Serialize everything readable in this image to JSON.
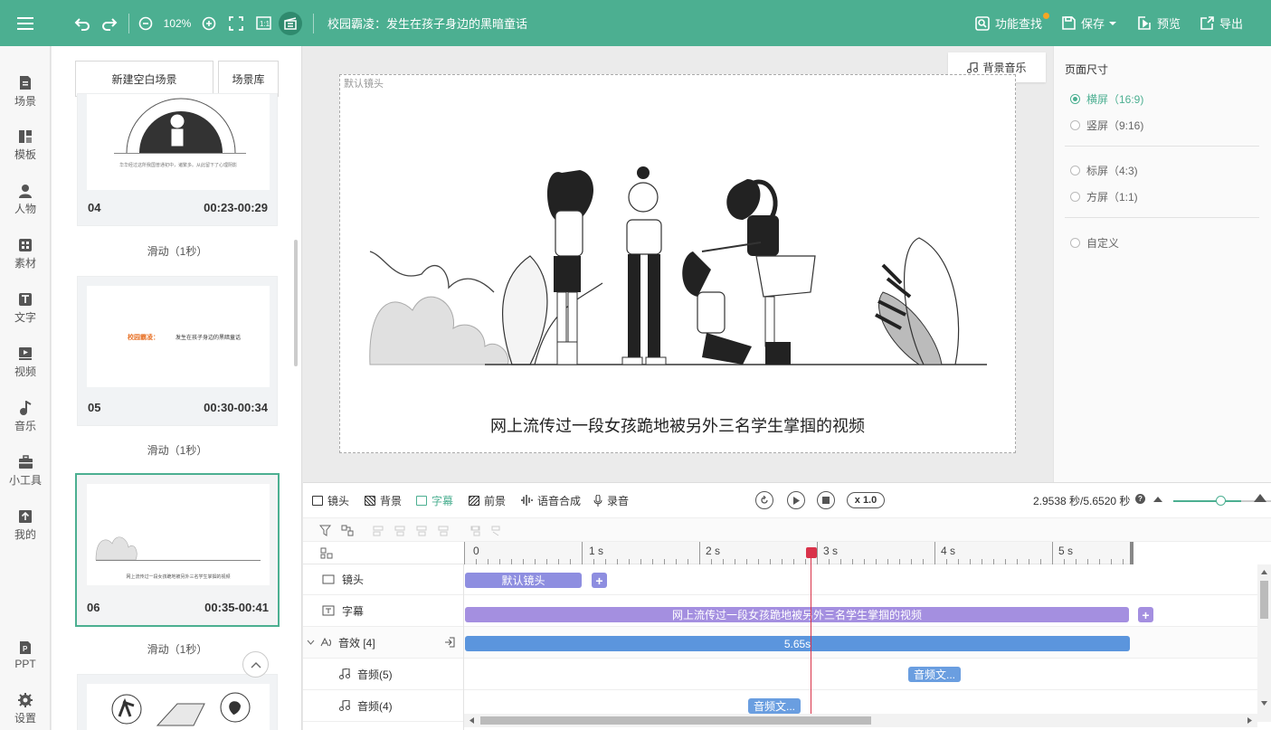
{
  "topbar": {
    "zoom": "102%",
    "title": "校园霸凌：发生在孩子身边的黑暗童话",
    "search_label": "功能查找",
    "save_label": "保存",
    "preview_label": "预览",
    "export_label": "导出"
  },
  "leftnav": {
    "items": [
      {
        "label": "场景",
        "icon": "scene-icon"
      },
      {
        "label": "模板",
        "icon": "template-icon"
      },
      {
        "label": "人物",
        "icon": "person-icon"
      },
      {
        "label": "素材",
        "icon": "material-icon"
      },
      {
        "label": "文字",
        "icon": "text-icon"
      },
      {
        "label": "视频",
        "icon": "video-icon"
      },
      {
        "label": "音乐",
        "icon": "music-icon"
      },
      {
        "label": "小工具",
        "icon": "toolbox-icon"
      },
      {
        "label": "我的",
        "icon": "upload-icon"
      },
      {
        "label": "PPT",
        "icon": "ppt-icon"
      },
      {
        "label": "设置",
        "icon": "gear-icon"
      }
    ]
  },
  "scenes": {
    "new_blank": "新建空白场景",
    "library": "场景库",
    "cards": [
      {
        "num": "04",
        "time": "00:23-00:29",
        "caption": "华华经过这所我国普通初中，诸繁多。从此留下了心理阴影"
      },
      {
        "num": "05",
        "time": "00:30-00:34",
        "caption_a": "校园霸凌：",
        "caption_b": "发生在孩子身边的黑暗童话"
      },
      {
        "num": "06",
        "time": "00:35-00:41",
        "caption": "网上流传过一段女孩跪地被另外三名学生掌掴的视频"
      }
    ],
    "transition": "滑动（1秒）"
  },
  "canvas": {
    "bg_music": "背景音乐",
    "camera_label": "默认镜头",
    "subtitle": "网上流传过一段女孩跪地被另外三名学生掌掴的视频"
  },
  "rightpanel": {
    "title": "页面尺寸",
    "options": [
      "横屏（16:9)",
      "竖屏（9:16)",
      "标屏（4:3)",
      "方屏（1:1)",
      "自定义"
    ],
    "selected": 0
  },
  "timeline": {
    "tabs": [
      "镜头",
      "背景",
      "字幕",
      "前景",
      "语音合成",
      "录音"
    ],
    "active_tab": 2,
    "speed": "x 1.0",
    "time_readout": "2.9538 秒/5.6520 秒",
    "ruler": [
      "0",
      "1 s",
      "2 s",
      "3 s",
      "4 s",
      "5 s"
    ],
    "playhead_seconds": 2.9538,
    "duration_seconds": 5.652,
    "rows": [
      {
        "label": "镜头",
        "icon": "camera-icon"
      },
      {
        "label": "字幕",
        "icon": "subtitle-icon"
      },
      {
        "label": "音效 [4]",
        "icon": "sound-effect-icon"
      },
      {
        "label": "音频(5)",
        "icon": "music-note-icon"
      },
      {
        "label": "音频(4)",
        "icon": "music-note-icon"
      }
    ],
    "clips": {
      "camera": "默认镜头",
      "subtitle": "网上流传过一段女孩跪地被另外三名学生掌掴的视频",
      "sound_effect": "5.65s",
      "audio5": "音频文...",
      "audio4": "音频文..."
    },
    "colors": {
      "camera": "#8e8ee0",
      "subtitle": "#a48fe0",
      "sound": "#5b95dd",
      "audio": "#6a9ee0",
      "playhead": "#d9334a",
      "accent": "#4caf91"
    }
  }
}
